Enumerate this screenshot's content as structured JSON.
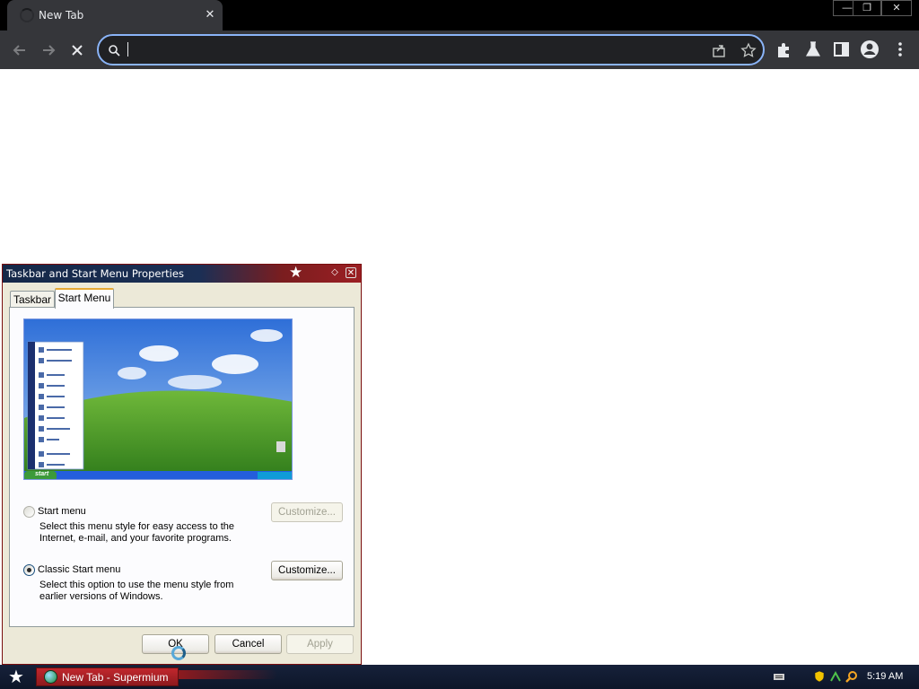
{
  "browser": {
    "tab_title": "New Tab",
    "tab_close": "✕",
    "window_controls": {
      "minimize": "—",
      "restore": "❐",
      "close": "✕"
    },
    "omnibox_value": ""
  },
  "dialog": {
    "title": "Taskbar and Start Menu Properties",
    "tabs": [
      "Taskbar",
      "Start Menu"
    ],
    "active_tab": "Start Menu",
    "options": [
      {
        "label": "Start menu",
        "description": "Select this menu style for easy access to the Internet, e-mail, and your favorite programs.",
        "selected": false,
        "customize_label": "Customize...",
        "customize_enabled": false
      },
      {
        "label": "Classic Start menu",
        "description": "Select this option to use the menu style from earlier versions of Windows.",
        "selected": true,
        "customize_label": "Customize...",
        "customize_enabled": true
      }
    ],
    "buttons": {
      "ok": "OK",
      "cancel": "Cancel",
      "apply": "Apply"
    },
    "preview_start_label": "start"
  },
  "taskbar": {
    "task_label": "New Tab - Supermium",
    "clock": "5:19 AM"
  },
  "colors": {
    "chrome_bg": "#35363a",
    "omnibox_border": "#8ab4f8",
    "dialog_bg": "#ece9d8",
    "taskbar_item": "#c1272d"
  }
}
